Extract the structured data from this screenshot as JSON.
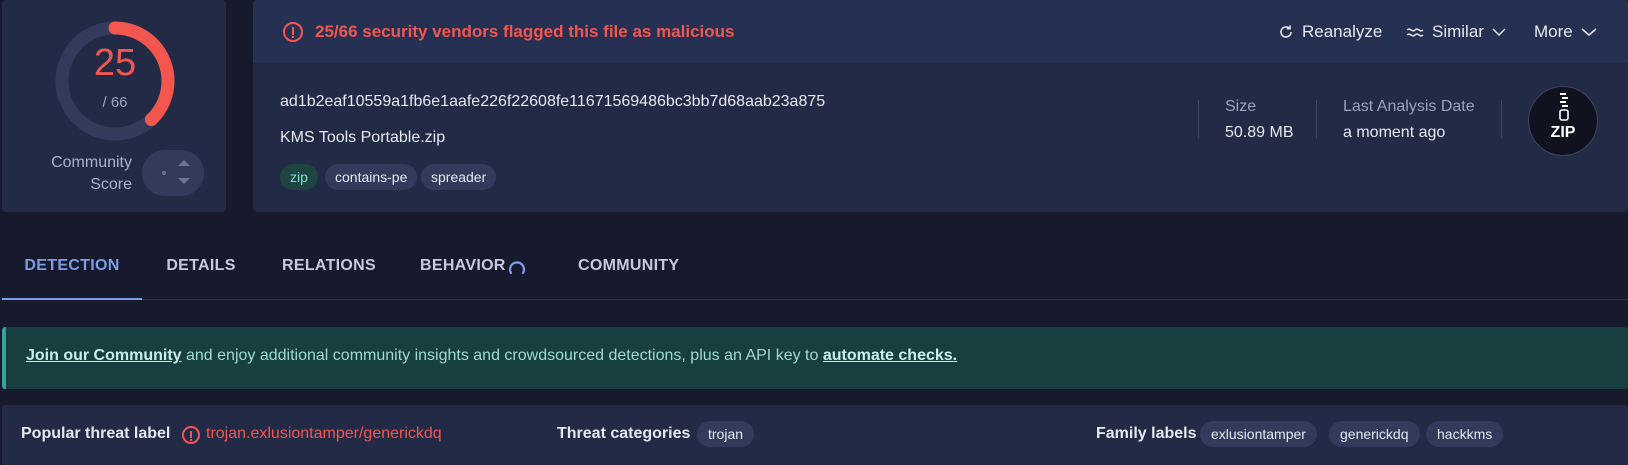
{
  "score": {
    "detected": "25",
    "total": "/ 66",
    "detected_fraction": 0.379,
    "community_label": "Community Score",
    "colors": {
      "ring_active": "#f2564f",
      "ring_track": "#323b5b"
    }
  },
  "alert": {
    "text": "25/66 security vendors flagged this file as malicious",
    "icon": "alert-circle-icon",
    "color": "#f2564f"
  },
  "actions": {
    "reanalyze": "Reanalyze",
    "similar": "Similar",
    "more": "More"
  },
  "file": {
    "hash": "ad1b2eaf10559a1fb6e1aafe226f22608fe11671569486bc3bb7d68aab23a875",
    "name": "KMS Tools Portable.zip",
    "tags": [
      "zip",
      "contains-pe",
      "spreader"
    ],
    "size_label": "Size",
    "size_value": "50.89 MB",
    "date_label": "Last Analysis Date",
    "date_value": "a moment ago",
    "type_icon_text": "ZIP"
  },
  "tabs": [
    "DETECTION",
    "DETAILS",
    "RELATIONS",
    "BEHAVIOR",
    "COMMUNITY"
  ],
  "banner": {
    "link1": "Join our Community",
    "middle": " and enjoy additional community insights and crowdsourced detections, plus an API key to ",
    "link2": "automate checks."
  },
  "threat": {
    "popular_label": "Popular threat label",
    "popular_value": "trojan.exlusiontamper/generickdq",
    "categories_label": "Threat categories",
    "categories": [
      "trojan"
    ],
    "family_label": "Family labels",
    "families": [
      "exlusiontamper",
      "generickdq",
      "hackkms"
    ]
  }
}
